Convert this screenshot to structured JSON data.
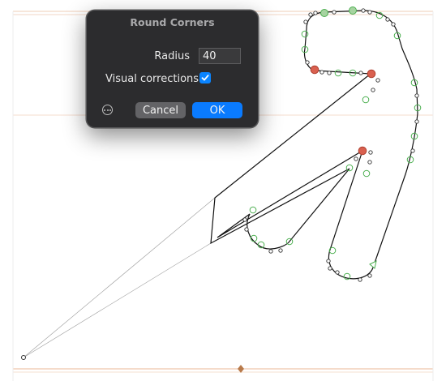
{
  "canvas": {
    "guide_color": "#f2cfb8",
    "anchor_color": "#b87a4b",
    "node_color_selected": "#d9604f",
    "node_color_smooth": "#4caf50"
  },
  "dialog": {
    "title": "Round Corners",
    "radius_label": "Radius",
    "radius_value": "40",
    "visual_corrections_label": "Visual corrections",
    "visual_corrections_checked": true,
    "cancel_label": "Cancel",
    "ok_label": "OK",
    "accent_color": "#0a84ff"
  }
}
